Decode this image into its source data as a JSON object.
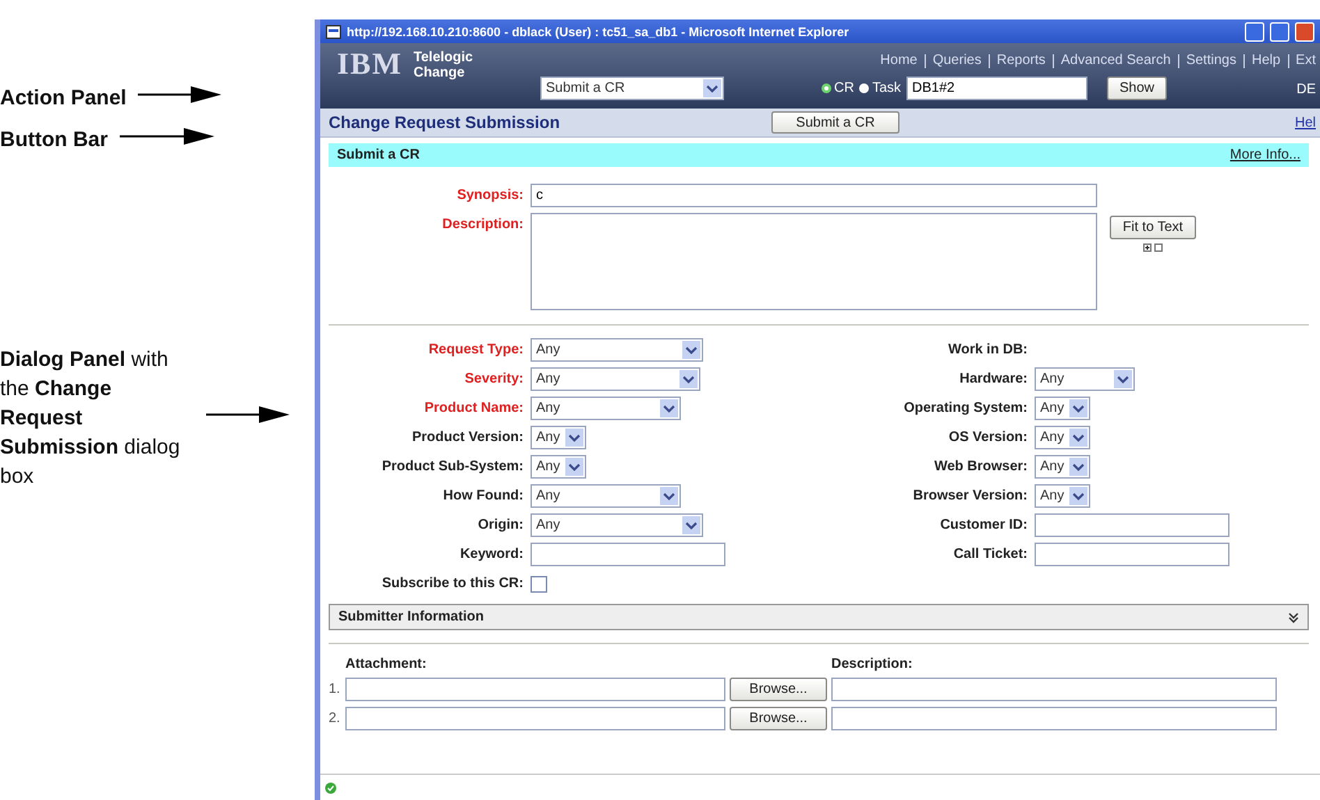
{
  "callouts": [
    {
      "text": "**Action Panel**"
    },
    {
      "text": "**Button Bar**"
    },
    {
      "text": "**Dialog Panel** with the **Change Request Submission** dialog box"
    }
  ],
  "window": {
    "title": "http://192.168.10.210:8600 - dblack (User) : tc51_sa_db1 - Microsoft Internet Explorer"
  },
  "header": {
    "logo": "IBM",
    "product": [
      "Telelogic",
      "Change"
    ],
    "nav": [
      "Home",
      "Queries",
      "Reports",
      "Advanced Search",
      "Settings",
      "Help",
      "Ext"
    ],
    "action_select": "Submit a CR",
    "radios": [
      {
        "label": "CR",
        "selected": true
      },
      {
        "label": "Task",
        "selected": false
      }
    ],
    "task_field": "DB1#2",
    "show_button": "Show",
    "db_label": "DE"
  },
  "button_bar": {
    "title": "Change Request Submission",
    "button": "Submit a CR",
    "help_link": "Hel"
  },
  "section": {
    "title": "Submit a CR",
    "link": "More Info...",
    "synopsis": {
      "label": "Synopsis:",
      "value": "c"
    },
    "description": {
      "label": "Description:"
    },
    "fit_button": "Fit to Text"
  },
  "fields_left": [
    {
      "label": "Request Type:",
      "required": true,
      "kind": "select",
      "value": "Any"
    },
    {
      "label": "Severity:",
      "required": true,
      "kind": "select",
      "value": "Any"
    },
    {
      "label": "Product Name:",
      "required": true,
      "kind": "select",
      "value": "Any"
    },
    {
      "label": "Product Version:",
      "required": false,
      "kind": "select",
      "value": "Any"
    },
    {
      "label": "Product Sub-System:",
      "required": false,
      "kind": "select",
      "value": "Any"
    },
    {
      "label": "How Found:",
      "required": false,
      "kind": "select",
      "value": "Any"
    },
    {
      "label": "Origin:",
      "required": false,
      "kind": "select",
      "value": "Any"
    },
    {
      "label": "Keyword:",
      "required": false,
      "kind": "text"
    },
    {
      "label": "Subscribe to this CR:",
      "required": false,
      "kind": "checkbox",
      "checked": false
    }
  ],
  "fields_right": [
    {
      "label": "Work in DB:",
      "kind": "none"
    },
    {
      "label": "Hardware:",
      "kind": "select",
      "value": "Any"
    },
    {
      "label": "Operating System:",
      "kind": "select",
      "value": "Any"
    },
    {
      "label": "OS Version:",
      "kind": "select",
      "value": "Any"
    },
    {
      "label": "Web Browser:",
      "kind": "select",
      "value": "Any"
    },
    {
      "label": "Browser Version:",
      "kind": "select",
      "value": "Any"
    },
    {
      "label": "Customer ID:",
      "kind": "text"
    },
    {
      "label": "Call Ticket:",
      "kind": "text"
    }
  ],
  "submitter": {
    "title": "Submitter Information",
    "expanded": false
  },
  "attachments": {
    "columns": [
      "Attachment:",
      "Description:"
    ],
    "rows": [
      {
        "number": "1.",
        "button": "Browse..."
      },
      {
        "number": "2.",
        "button": "Browse..."
      }
    ]
  }
}
